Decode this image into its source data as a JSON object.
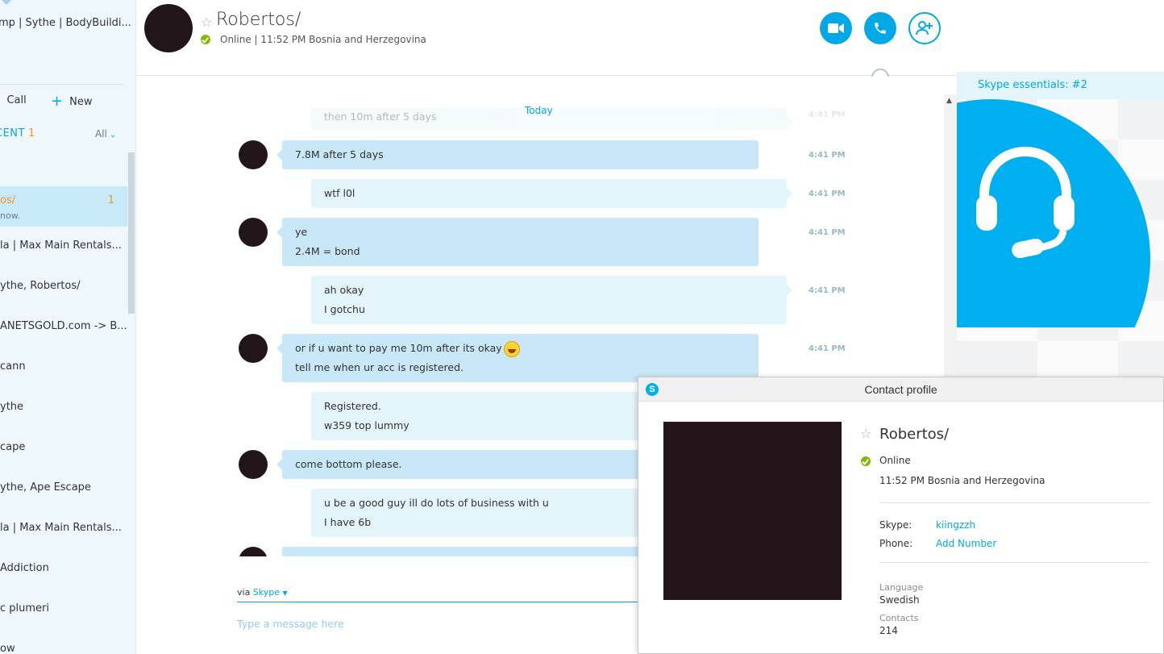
{
  "sidebar": {
    "group_title": "mp | Sythe | BodyBuildi...",
    "call_label": "Call",
    "new_label": "New",
    "recent_label": "CENT",
    "recent_count": "1",
    "filter_label": "All",
    "contacts": [
      {
        "name": "os/",
        "sub": "now.",
        "badge": "1"
      },
      {
        "name": "la | Max Main Rentals..."
      },
      {
        "name": "ythe, Robertos/"
      },
      {
        "name": "ANETSGOLD.com -> B..."
      },
      {
        "name": "cann"
      },
      {
        "name": "ythe"
      },
      {
        "name": "cape"
      },
      {
        "name": "ythe, Ape Escape"
      },
      {
        "name": "la | Max Main Rentals..."
      },
      {
        "name": "Addiction"
      },
      {
        "name": "c plumeri"
      },
      {
        "name": "ow"
      }
    ]
  },
  "header": {
    "name": "Robertos/",
    "status": "Online  |  11:52 PM Bosnia and Herzegovina"
  },
  "chat": {
    "day_label": "Today",
    "messages": [
      {
        "dir": "out",
        "lines": [
          "then 10m after 5 days"
        ],
        "time": "4:41 PM"
      },
      {
        "dir": "in",
        "lines": [
          "7.8M after 5 days"
        ],
        "time": "4:41 PM"
      },
      {
        "dir": "out",
        "lines": [
          "wtf l0l"
        ],
        "time": "4:41 PM"
      },
      {
        "dir": "in",
        "lines": [
          "ye",
          "2.4M = bond"
        ],
        "time": "4:41 PM"
      },
      {
        "dir": "out",
        "lines": [
          "ah okay",
          "I gotchu"
        ],
        "time": "4:41 PM"
      },
      {
        "dir": "in",
        "lines": [
          "or if u want to pay me 10m after its okay",
          "tell me when ur acc is registered."
        ],
        "time": "4:41 PM"
      },
      {
        "dir": "out",
        "lines": [
          "Registered.",
          "w359 top lummy"
        ]
      },
      {
        "dir": "in",
        "lines": [
          "come bottom please."
        ]
      },
      {
        "dir": "out",
        "lines": [
          "u be a good guy ill do lots of business with u",
          "I have 6b"
        ]
      }
    ]
  },
  "composer": {
    "via_prefix": "via",
    "via_service": "Skype",
    "placeholder": "Type a message here"
  },
  "right_panel": {
    "essentials_label": "Skype essentials: #2"
  },
  "profile": {
    "title": "Contact profile",
    "name": "Robertos/",
    "status": "Online",
    "local_time": "11:52 PM Bosnia and Herzegovina",
    "skype_label": "Skype:",
    "skype_value": "kiingzzh",
    "phone_label": "Phone:",
    "phone_value": "Add Number",
    "language_label": "Language",
    "language_value": "Swedish",
    "contacts_label": "Contacts",
    "contacts_value": "214"
  },
  "colors": {
    "accent": "#00a8e6",
    "unread": "#f7931e",
    "online": "#7fba00",
    "bubble_in": "#c8e8f9",
    "bubble_out": "#e3f4fb"
  },
  "icons": [
    "dialpad-icon",
    "plus-icon",
    "chevron-down-icon",
    "star-icon",
    "status-online-icon",
    "video-call-icon",
    "audio-call-icon",
    "add-contact-icon",
    "globe-icon",
    "headset-icon",
    "skype-logo-icon",
    "emoji-icon"
  ]
}
